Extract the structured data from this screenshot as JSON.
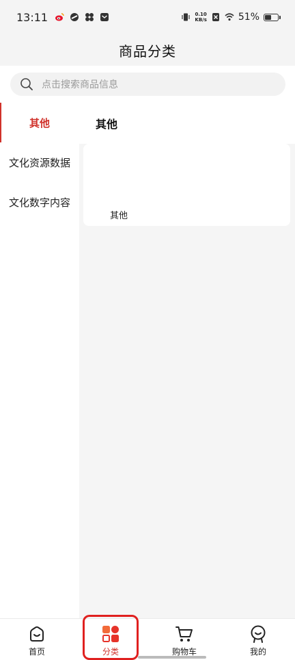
{
  "status_bar": {
    "time": "13:11",
    "net_speed_value": "0.10",
    "net_speed_unit": "KB/s",
    "battery_percent": "51%",
    "battery_level": 0.51
  },
  "header": {
    "title": "商品分类"
  },
  "search": {
    "placeholder": "点击搜索商品信息"
  },
  "sidebar": {
    "items": [
      {
        "label": "其他",
        "active": true
      },
      {
        "label": "文化资源数据",
        "active": false
      },
      {
        "label": "文化数字内容",
        "active": false
      }
    ]
  },
  "content": {
    "heading": "其他",
    "items": [
      {
        "label": "其他"
      }
    ]
  },
  "tabbar": {
    "tabs": [
      {
        "label": "首页",
        "icon": "home-icon"
      },
      {
        "label": "分类",
        "icon": "category-icon",
        "active": true
      },
      {
        "label": "购物车",
        "icon": "cart-icon"
      },
      {
        "label": "我的",
        "icon": "profile-icon"
      }
    ]
  },
  "colors": {
    "accent": "#d0322b",
    "highlight": "#e0201f",
    "background": "#f5f5f5"
  }
}
